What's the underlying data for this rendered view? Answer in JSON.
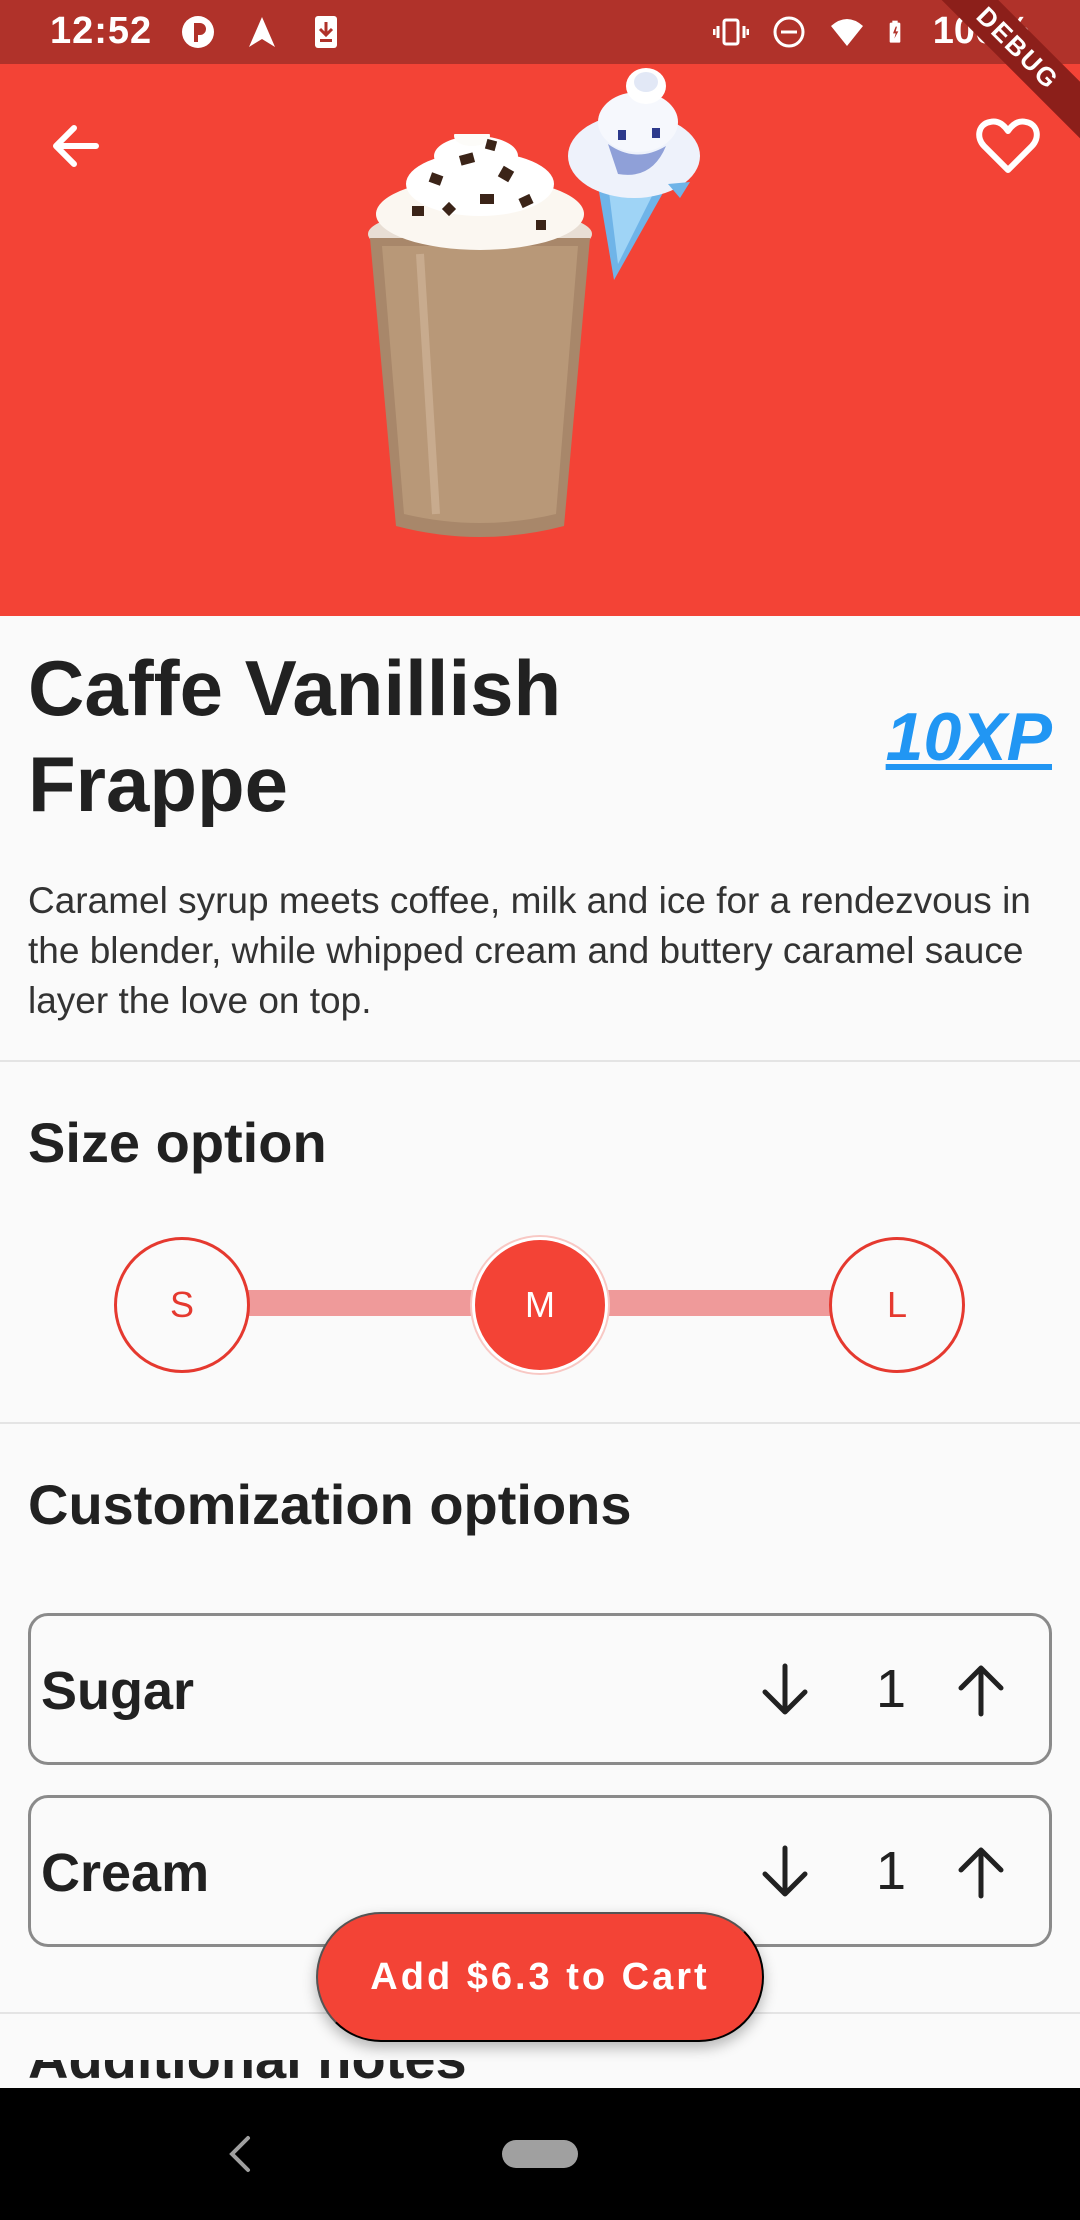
{
  "status_bar": {
    "time": "12:52",
    "battery": "100%",
    "left_icons": [
      "badge-icon",
      "navigation-icon",
      "download-icon"
    ],
    "right_icons": [
      "vibrate-icon",
      "dnd-icon",
      "wifi-icon",
      "battery-charging-icon"
    ]
  },
  "debug_banner": "DEBUG",
  "hero": {
    "background_color": "#f34336",
    "back_icon": "arrow-left-icon",
    "favorite_icon": "heart-outline-icon"
  },
  "product": {
    "title": "Caffe Vanillish Frappe",
    "xp": "10XP",
    "description": "Caramel syrup meets coffee, milk and ice for a rendezvous in the blender, while whipped cream and buttery caramel sauce layer the love on top."
  },
  "size": {
    "title": "Size option",
    "options": [
      "S",
      "M",
      "L"
    ],
    "selected": "M"
  },
  "customization": {
    "title": "Customization options",
    "items": [
      {
        "label": "Sugar",
        "quantity": "1"
      },
      {
        "label": "Cream",
        "quantity": "1"
      }
    ]
  },
  "cart": {
    "button_label": "Add $6.3 to Cart"
  },
  "additional": {
    "title": "Additional notes"
  },
  "colors": {
    "accent": "#f34336",
    "status_bar": "#b0322a",
    "link": "#2196f3",
    "track": "#ef9a9a"
  }
}
